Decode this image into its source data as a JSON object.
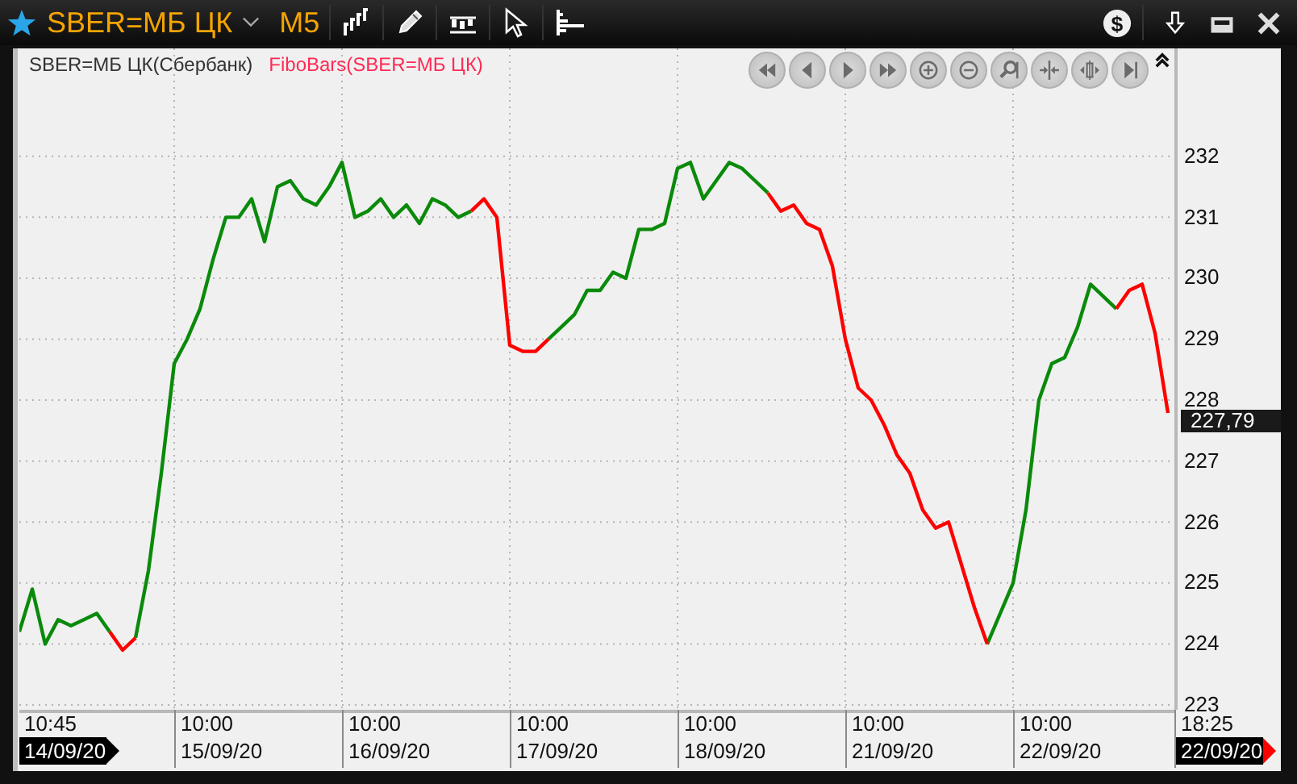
{
  "toolbar": {
    "symbol": "SBER=МБ ЦК",
    "timeframe": "M5",
    "currency_icon": "$"
  },
  "legend": [
    {
      "text": "SBER=МБ ЦК(Сбербанк)",
      "color": "#333333"
    },
    {
      "text": "FiboBars(SBER=МБ ЦК)",
      "color": "#ff2a55"
    }
  ],
  "price_tag": {
    "text": "227,79"
  },
  "x_axis": [
    {
      "time": "10:45",
      "date": "14/09/20",
      "highlighted": true,
      "color": "#000000"
    },
    {
      "time": "10:00",
      "date": "15/09/20",
      "highlighted": false
    },
    {
      "time": "10:00",
      "date": "16/09/20",
      "highlighted": false
    },
    {
      "time": "10:00",
      "date": "17/09/20",
      "highlighted": false
    },
    {
      "time": "10:00",
      "date": "18/09/20",
      "highlighted": false
    },
    {
      "time": "10:00",
      "date": "21/09/20",
      "highlighted": false
    },
    {
      "time": "10:00",
      "date": "22/09/20",
      "highlighted": false
    },
    {
      "time": "18:25",
      "date": "22/09/20",
      "highlighted": true,
      "color": "#ff0000"
    }
  ],
  "chart_data": {
    "type": "line",
    "grid": true,
    "ylim": [
      222.92,
      233.77
    ],
    "yticks": [
      {
        "value": 223,
        "label": "223"
      },
      {
        "value": 224,
        "label": "224"
      },
      {
        "value": 225,
        "label": "225"
      },
      {
        "value": 226,
        "label": "226"
      },
      {
        "value": 227,
        "label": "227"
      },
      {
        "value": 228,
        "label": "228"
      },
      {
        "value": 229,
        "label": "229"
      },
      {
        "value": 230,
        "label": "230"
      },
      {
        "value": 231,
        "label": "231"
      },
      {
        "value": 232,
        "label": "232"
      }
    ],
    "series": [
      {
        "color": "#0a8a0a",
        "values": [
          224.2,
          224.9,
          224.0,
          224.4,
          224.3,
          224.4,
          224.5,
          224.2,
          null,
          224.1,
          225.2,
          226.8,
          228.6,
          229.0,
          229.5,
          230.3,
          231.0,
          231.0,
          231.3,
          230.6,
          231.5,
          231.6,
          231.3,
          231.2,
          231.5,
          231.9,
          231.0,
          231.1,
          231.3,
          231.0,
          231.2,
          230.9,
          231.3,
          231.2,
          231.0,
          231.1,
          null,
          null,
          null,
          null,
          null,
          229.0,
          229.2,
          229.4,
          229.8,
          229.8,
          230.1,
          230.0,
          230.8,
          230.8,
          230.9,
          231.8,
          231.9,
          231.3,
          231.6,
          231.9,
          231.8,
          231.6,
          231.4,
          null,
          null,
          null,
          null,
          null,
          null,
          null,
          null,
          null,
          null,
          null,
          null,
          null,
          null,
          null,
          null,
          224.0,
          224.5,
          225.0,
          226.2,
          228.0,
          228.6,
          228.7,
          229.2,
          229.9,
          229.7,
          229.5,
          null,
          null,
          null,
          null
        ]
      },
      {
        "color": "#ff0000",
        "values": [
          null,
          null,
          null,
          null,
          null,
          null,
          null,
          224.2,
          223.9,
          224.1,
          null,
          null,
          null,
          null,
          null,
          null,
          null,
          null,
          null,
          null,
          null,
          null,
          null,
          null,
          null,
          null,
          null,
          null,
          null,
          null,
          null,
          null,
          null,
          null,
          null,
          231.1,
          231.3,
          231.0,
          228.9,
          228.8,
          228.8,
          229.0,
          null,
          null,
          null,
          null,
          null,
          null,
          null,
          null,
          null,
          null,
          null,
          null,
          null,
          null,
          null,
          null,
          231.4,
          231.1,
          231.2,
          230.9,
          230.8,
          230.2,
          229.0,
          228.2,
          228.0,
          227.6,
          227.1,
          226.8,
          226.2,
          225.9,
          226.0,
          225.3,
          224.6,
          224.0,
          null,
          null,
          null,
          null,
          null,
          null,
          null,
          null,
          null,
          229.5,
          229.8,
          229.9,
          229.1,
          227.79
        ]
      }
    ]
  }
}
